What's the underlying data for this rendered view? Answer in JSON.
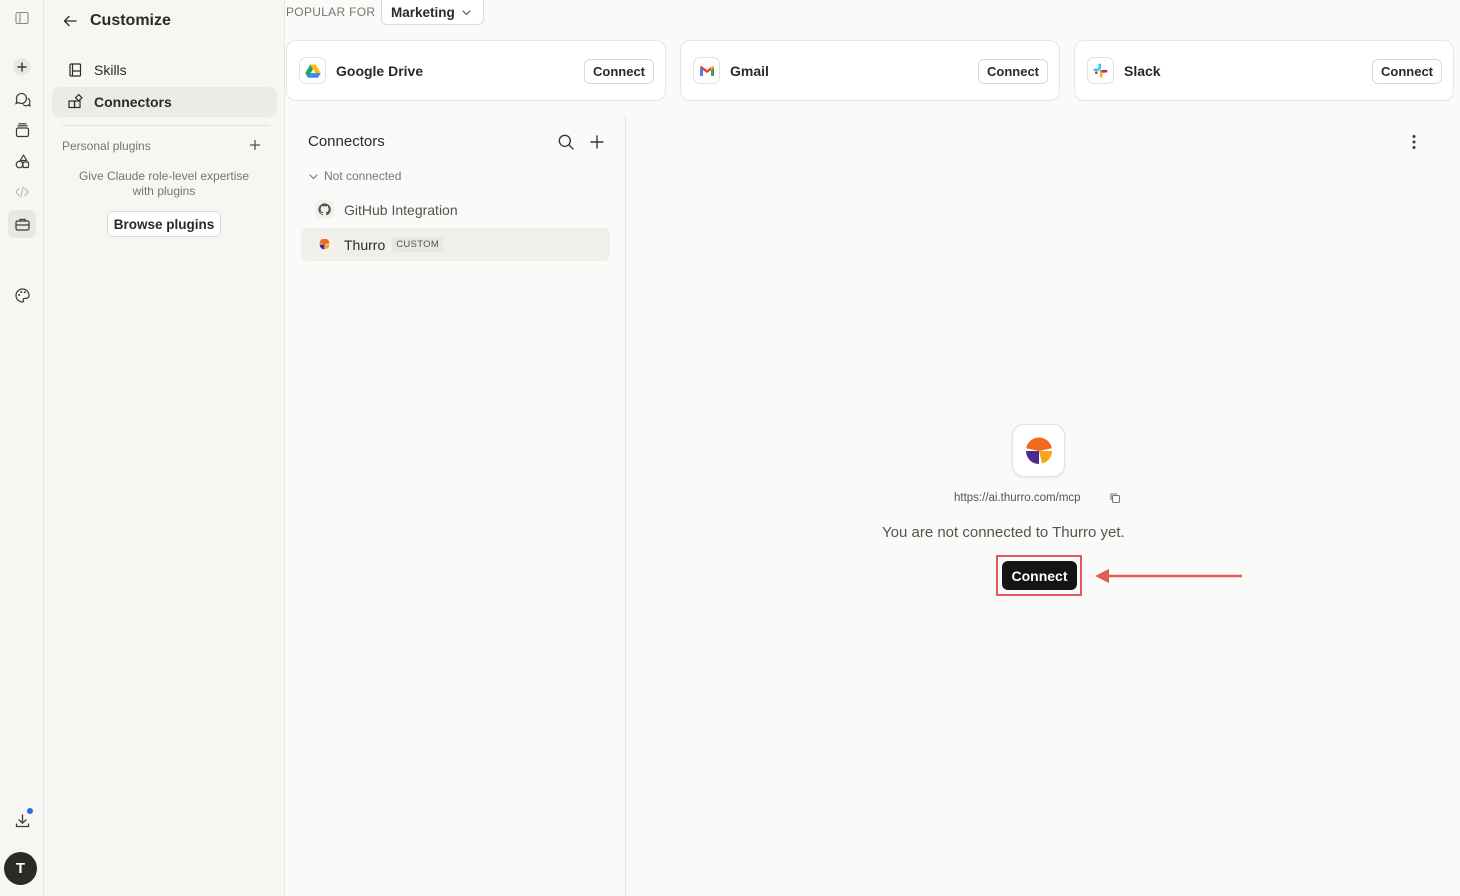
{
  "customize": {
    "title": "Customize",
    "nav": [
      {
        "label": "Skills",
        "icon": "book-icon"
      },
      {
        "label": "Connectors",
        "icon": "connectors-icon"
      }
    ],
    "plugins_label": "Personal plugins",
    "plugins_description": "Give Claude role-level expertise with plugins",
    "browse_label": "Browse plugins"
  },
  "popular": {
    "label": "POPULAR FOR",
    "selected": "Marketing"
  },
  "apps": [
    {
      "name": "Google Drive",
      "connect_label": "Connect"
    },
    {
      "name": "Gmail",
      "connect_label": "Connect"
    },
    {
      "name": "Slack",
      "connect_label": "Connect"
    }
  ],
  "connectors": {
    "title": "Connectors",
    "group": "Not connected",
    "items": [
      {
        "name": "GitHub Integration",
        "badge": ""
      },
      {
        "name": "Thurro",
        "badge": "CUSTOM"
      }
    ]
  },
  "detail": {
    "url": "https://ai.thurro.com/mcp",
    "status": "You are not connected to Thurro yet.",
    "connect_label": "Connect"
  },
  "user": {
    "initial": "T"
  },
  "colors": {
    "accent": "#141413",
    "highlight": "#e15a5a",
    "notification": "#2a6fd6"
  }
}
